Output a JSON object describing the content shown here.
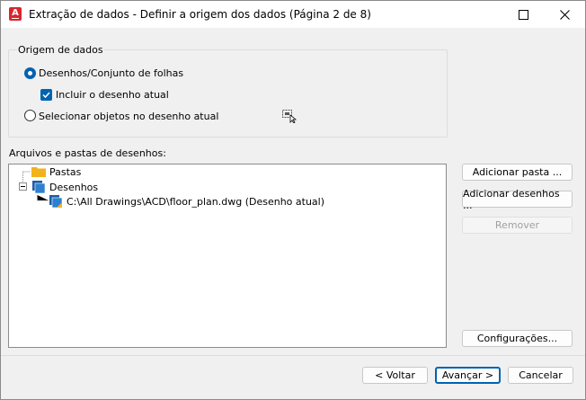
{
  "window": {
    "title": "Extração de dados - Definir a origem dos dados (Página 2 de 8)",
    "app_icon_letter": "A"
  },
  "source_group": {
    "label": "Origem de dados",
    "option_drawings": {
      "label": "Desenhos/Conjunto de folhas",
      "checked": true
    },
    "include_current": {
      "label": "Incluir o desenho atual",
      "checked": true
    },
    "option_select_objects": {
      "label": "Selecionar objetos no desenho atual",
      "checked": false
    }
  },
  "files_label": "Arquivos e pastas de desenhos:",
  "tree": {
    "folders_label": "Pastas",
    "drawings_label": "Desenhos",
    "drawing_item": "C:\\All Drawings\\ACD\\floor_plan.dwg (Desenho atual)"
  },
  "buttons": {
    "add_folder": "Adicionar pasta ...",
    "add_drawings": "Adicionar desenhos ...",
    "remove": "Remover",
    "settings": "Configurações...",
    "back": "< Voltar",
    "next": "Avançar >",
    "cancel": "Cancelar"
  },
  "colors": {
    "accent": "#0063b1",
    "folder": "#f2b21a",
    "app_icon": "#d9262c"
  }
}
